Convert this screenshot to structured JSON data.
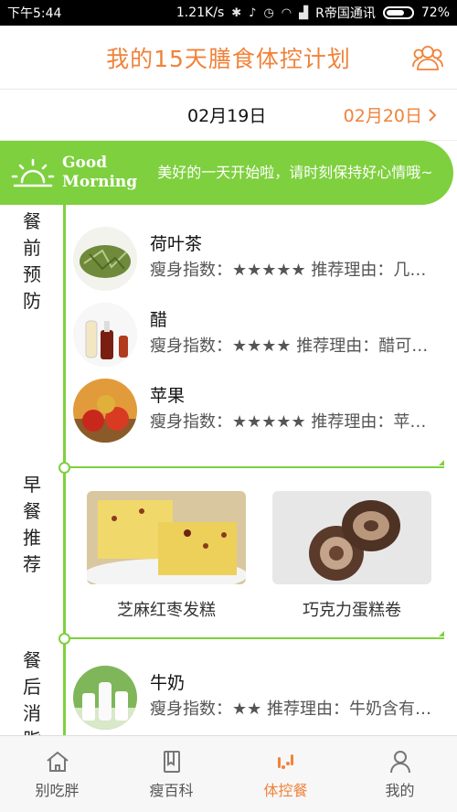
{
  "status_bar": {
    "time": "下午5:44",
    "speed": "1.21K/s",
    "carrier": "R帝国通讯",
    "battery": "72%",
    "battery_level": 0.72
  },
  "header": {
    "title": "我的15天膳食体控计划",
    "users_icon": "users-icon"
  },
  "dates": {
    "current": "02月19日",
    "next": "02月20日"
  },
  "banner": {
    "greeting_line1": "Good",
    "greeting_line2": "Morning",
    "message": "美好的一天开始啦，请时刻保持好心情哦~"
  },
  "sections": {
    "pre_meal": {
      "label": "餐前预防",
      "items": [
        {
          "name": "荷叶茶",
          "desc": "瘦身指数：★★★★★ 推荐理由：几…"
        },
        {
          "name": "醋",
          "desc": "瘦身指数：★★★★ 推荐理由：醋可…"
        },
        {
          "name": "苹果",
          "desc": "瘦身指数：★★★★★ 推荐理由：苹…"
        }
      ]
    },
    "breakfast": {
      "label": "早餐推荐",
      "cards": [
        {
          "caption": "芝麻红枣发糕"
        },
        {
          "caption": "巧克力蛋糕卷"
        }
      ]
    },
    "post_meal": {
      "label": "餐后消脂",
      "items": [
        {
          "name": "牛奶",
          "desc": "瘦身指数：★★ 推荐理由：牛奶含有…"
        }
      ]
    }
  },
  "tabbar": {
    "tabs": [
      {
        "label": "别吃胖",
        "icon": "home-icon"
      },
      {
        "label": "瘦百科",
        "icon": "book-icon"
      },
      {
        "label": "体控餐",
        "icon": "footprints-icon"
      },
      {
        "label": "我的",
        "icon": "person-icon"
      }
    ],
    "active_index": 2
  },
  "colors": {
    "accent": "#f1823a",
    "green": "#7ed03e"
  }
}
